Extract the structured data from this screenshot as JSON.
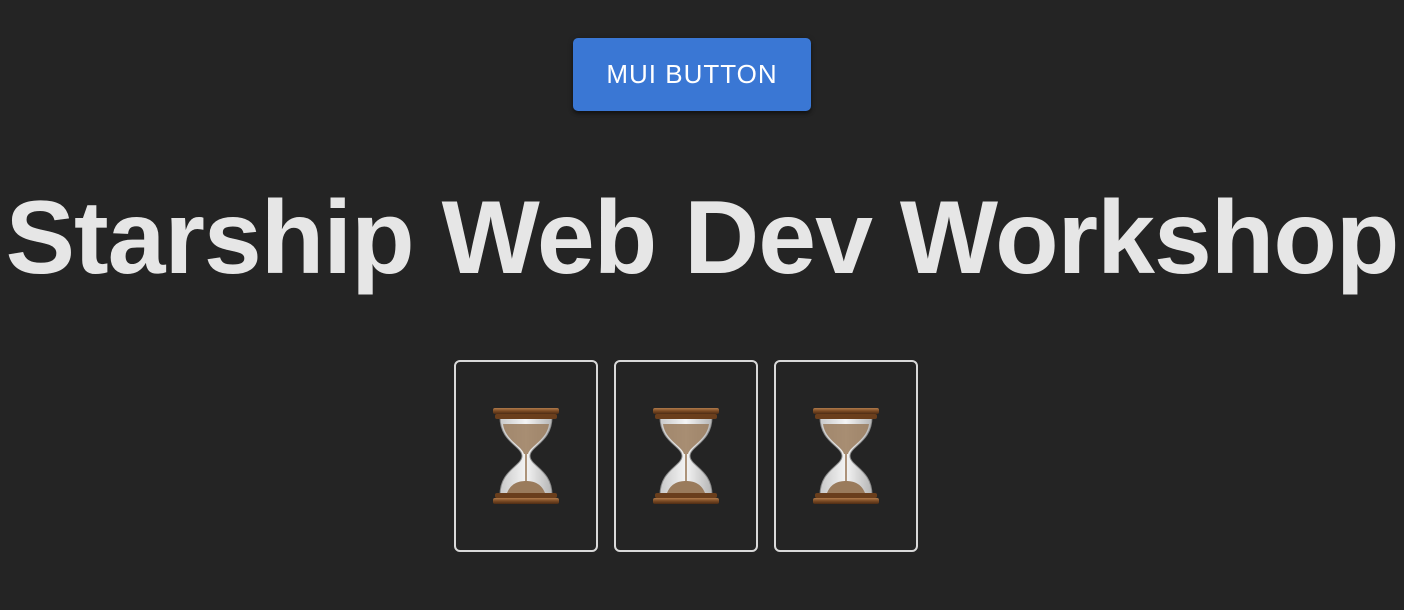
{
  "header": {
    "button_label": "MUI BUTTON"
  },
  "main": {
    "title": "Starship Web Dev Workshop",
    "cards": [
      {
        "icon": "hourglass-icon"
      },
      {
        "icon": "hourglass-icon"
      },
      {
        "icon": "hourglass-icon"
      }
    ]
  },
  "colors": {
    "background": "#242424",
    "button": "#3a77d4",
    "title": "#e6e6e6",
    "card_border": "#d9d9d9"
  }
}
